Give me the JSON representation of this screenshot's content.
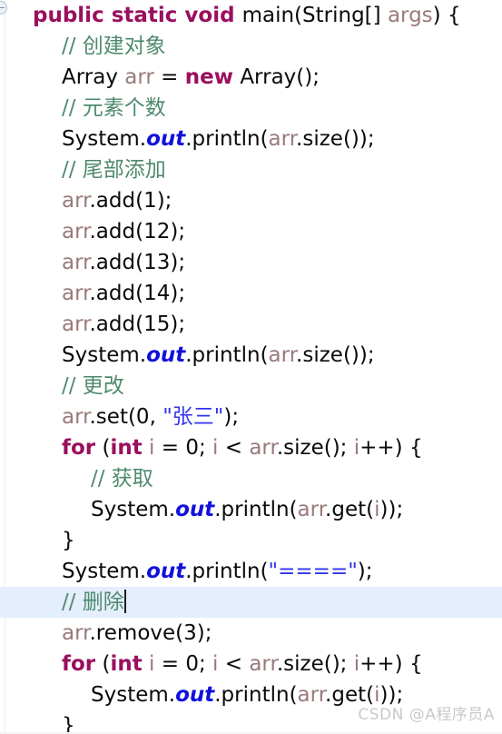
{
  "editor": {
    "language": "Java",
    "background_color": "#ffffff",
    "caret_line_highlight_color": "#e4eefc",
    "gutter_fold_icon": "fold-collapse-icon",
    "colors": {
      "keyword": "#9a0f5e",
      "comment": "#4f8a6e",
      "static_field": "#1111dd",
      "string": "#3333ee",
      "variable": "#9a7a7a",
      "plain": "#0a0a0a",
      "watermark": "#c9c9c9"
    },
    "lines": [
      {
        "indent": 0,
        "highlight": false,
        "caret": false,
        "tokens": [
          {
            "t": "public static void ",
            "c": "kw"
          },
          {
            "t": "main(String[] ",
            "c": "plain"
          },
          {
            "t": "args",
            "c": "var"
          },
          {
            "t": ") {",
            "c": "plain"
          }
        ]
      },
      {
        "indent": 1,
        "highlight": false,
        "caret": false,
        "tokens": [
          {
            "t": "// 创建对象",
            "c": "cmt"
          }
        ]
      },
      {
        "indent": 1,
        "highlight": false,
        "caret": false,
        "tokens": [
          {
            "t": "Array ",
            "c": "plain"
          },
          {
            "t": "arr",
            "c": "var"
          },
          {
            "t": " = ",
            "c": "plain"
          },
          {
            "t": "new",
            "c": "kw"
          },
          {
            "t": " Array();",
            "c": "plain"
          }
        ]
      },
      {
        "indent": 1,
        "highlight": false,
        "caret": false,
        "tokens": [
          {
            "t": "// 元素个数",
            "c": "cmt"
          }
        ]
      },
      {
        "indent": 1,
        "highlight": false,
        "caret": false,
        "tokens": [
          {
            "t": "System.",
            "c": "plain"
          },
          {
            "t": "out",
            "c": "fld"
          },
          {
            "t": ".println(",
            "c": "plain"
          },
          {
            "t": "arr",
            "c": "var"
          },
          {
            "t": ".size());",
            "c": "plain"
          }
        ]
      },
      {
        "indent": 1,
        "highlight": false,
        "caret": false,
        "tokens": [
          {
            "t": "// 尾部添加",
            "c": "cmt"
          }
        ]
      },
      {
        "indent": 1,
        "highlight": false,
        "caret": false,
        "tokens": [
          {
            "t": "arr",
            "c": "var"
          },
          {
            "t": ".add(1);",
            "c": "plain"
          }
        ]
      },
      {
        "indent": 1,
        "highlight": false,
        "caret": false,
        "tokens": [
          {
            "t": "arr",
            "c": "var"
          },
          {
            "t": ".add(12);",
            "c": "plain"
          }
        ]
      },
      {
        "indent": 1,
        "highlight": false,
        "caret": false,
        "tokens": [
          {
            "t": "arr",
            "c": "var"
          },
          {
            "t": ".add(13);",
            "c": "plain"
          }
        ]
      },
      {
        "indent": 1,
        "highlight": false,
        "caret": false,
        "tokens": [
          {
            "t": "arr",
            "c": "var"
          },
          {
            "t": ".add(14);",
            "c": "plain"
          }
        ]
      },
      {
        "indent": 1,
        "highlight": false,
        "caret": false,
        "tokens": [
          {
            "t": "arr",
            "c": "var"
          },
          {
            "t": ".add(15);",
            "c": "plain"
          }
        ]
      },
      {
        "indent": 1,
        "highlight": false,
        "caret": false,
        "tokens": [
          {
            "t": "System.",
            "c": "plain"
          },
          {
            "t": "out",
            "c": "fld"
          },
          {
            "t": ".println(",
            "c": "plain"
          },
          {
            "t": "arr",
            "c": "var"
          },
          {
            "t": ".size());",
            "c": "plain"
          }
        ]
      },
      {
        "indent": 1,
        "highlight": false,
        "caret": false,
        "tokens": [
          {
            "t": "// 更改",
            "c": "cmt"
          }
        ]
      },
      {
        "indent": 1,
        "highlight": false,
        "caret": false,
        "tokens": [
          {
            "t": "arr",
            "c": "var"
          },
          {
            "t": ".set(0, ",
            "c": "plain"
          },
          {
            "t": "\"张三\"",
            "c": "str"
          },
          {
            "t": ");",
            "c": "plain"
          }
        ]
      },
      {
        "indent": 1,
        "highlight": false,
        "caret": false,
        "tokens": [
          {
            "t": "for",
            "c": "kw"
          },
          {
            "t": " (",
            "c": "plain"
          },
          {
            "t": "int",
            "c": "kw"
          },
          {
            "t": " ",
            "c": "plain"
          },
          {
            "t": "i",
            "c": "var"
          },
          {
            "t": " = 0; ",
            "c": "plain"
          },
          {
            "t": "i",
            "c": "var"
          },
          {
            "t": " < ",
            "c": "plain"
          },
          {
            "t": "arr",
            "c": "var"
          },
          {
            "t": ".size(); ",
            "c": "plain"
          },
          {
            "t": "i",
            "c": "var"
          },
          {
            "t": "++) {",
            "c": "plain"
          }
        ]
      },
      {
        "indent": 2,
        "highlight": false,
        "caret": false,
        "tokens": [
          {
            "t": "// 获取",
            "c": "cmt"
          }
        ]
      },
      {
        "indent": 2,
        "highlight": false,
        "caret": false,
        "tokens": [
          {
            "t": "System.",
            "c": "plain"
          },
          {
            "t": "out",
            "c": "fld"
          },
          {
            "t": ".println(",
            "c": "plain"
          },
          {
            "t": "arr",
            "c": "var"
          },
          {
            "t": ".get(",
            "c": "plain"
          },
          {
            "t": "i",
            "c": "var"
          },
          {
            "t": "));",
            "c": "plain"
          }
        ]
      },
      {
        "indent": 1,
        "highlight": false,
        "caret": false,
        "tokens": [
          {
            "t": "}",
            "c": "plain"
          }
        ]
      },
      {
        "indent": 1,
        "highlight": false,
        "caret": false,
        "tokens": [
          {
            "t": "System.",
            "c": "plain"
          },
          {
            "t": "out",
            "c": "fld"
          },
          {
            "t": ".println(",
            "c": "plain"
          },
          {
            "t": "\"====\"",
            "c": "str"
          },
          {
            "t": ");",
            "c": "plain"
          }
        ]
      },
      {
        "indent": 1,
        "highlight": true,
        "caret": true,
        "tokens": [
          {
            "t": "// 删除",
            "c": "cmt"
          }
        ]
      },
      {
        "indent": 1,
        "highlight": false,
        "caret": false,
        "tokens": [
          {
            "t": "arr",
            "c": "var"
          },
          {
            "t": ".remove(3);",
            "c": "plain"
          }
        ]
      },
      {
        "indent": 1,
        "highlight": false,
        "caret": false,
        "tokens": [
          {
            "t": "for",
            "c": "kw"
          },
          {
            "t": " (",
            "c": "plain"
          },
          {
            "t": "int",
            "c": "kw"
          },
          {
            "t": " ",
            "c": "plain"
          },
          {
            "t": "i",
            "c": "var"
          },
          {
            "t": " = 0; ",
            "c": "plain"
          },
          {
            "t": "i",
            "c": "var"
          },
          {
            "t": " < ",
            "c": "plain"
          },
          {
            "t": "arr",
            "c": "var"
          },
          {
            "t": ".size(); ",
            "c": "plain"
          },
          {
            "t": "i",
            "c": "var"
          },
          {
            "t": "++) {",
            "c": "plain"
          }
        ]
      },
      {
        "indent": 2,
        "highlight": false,
        "caret": false,
        "tokens": [
          {
            "t": "System.",
            "c": "plain"
          },
          {
            "t": "out",
            "c": "fld"
          },
          {
            "t": ".println(",
            "c": "plain"
          },
          {
            "t": "arr",
            "c": "var"
          },
          {
            "t": ".get(",
            "c": "plain"
          },
          {
            "t": "i",
            "c": "var"
          },
          {
            "t": "));",
            "c": "plain"
          }
        ]
      },
      {
        "indent": 1,
        "highlight": false,
        "caret": false,
        "tokens": [
          {
            "t": "}",
            "c": "plain"
          }
        ]
      }
    ]
  },
  "watermark": {
    "text": "CSDN @A程序员A"
  }
}
